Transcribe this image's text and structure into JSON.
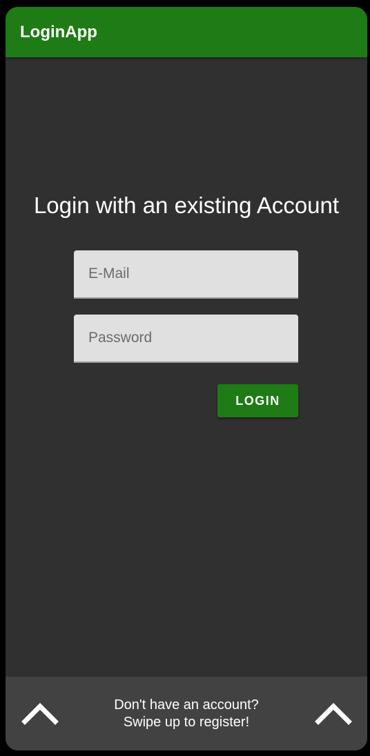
{
  "app_bar": {
    "title": "LoginApp"
  },
  "login": {
    "heading": "Login with an existing Account",
    "email": {
      "value": "",
      "placeholder": "E-Mail"
    },
    "password": {
      "value": "",
      "placeholder": "Password"
    },
    "button_label": "LOGIN"
  },
  "register_prompt": {
    "line1": "Don't have an account?",
    "line2": "Swipe up to register!",
    "left_icon": "chevron-up-icon",
    "right_icon": "chevron-up-icon"
  },
  "colors": {
    "accent": "#1e7b16",
    "background": "#303030",
    "bottom_bar": "#424242",
    "field_background": "#e0e0e0"
  }
}
